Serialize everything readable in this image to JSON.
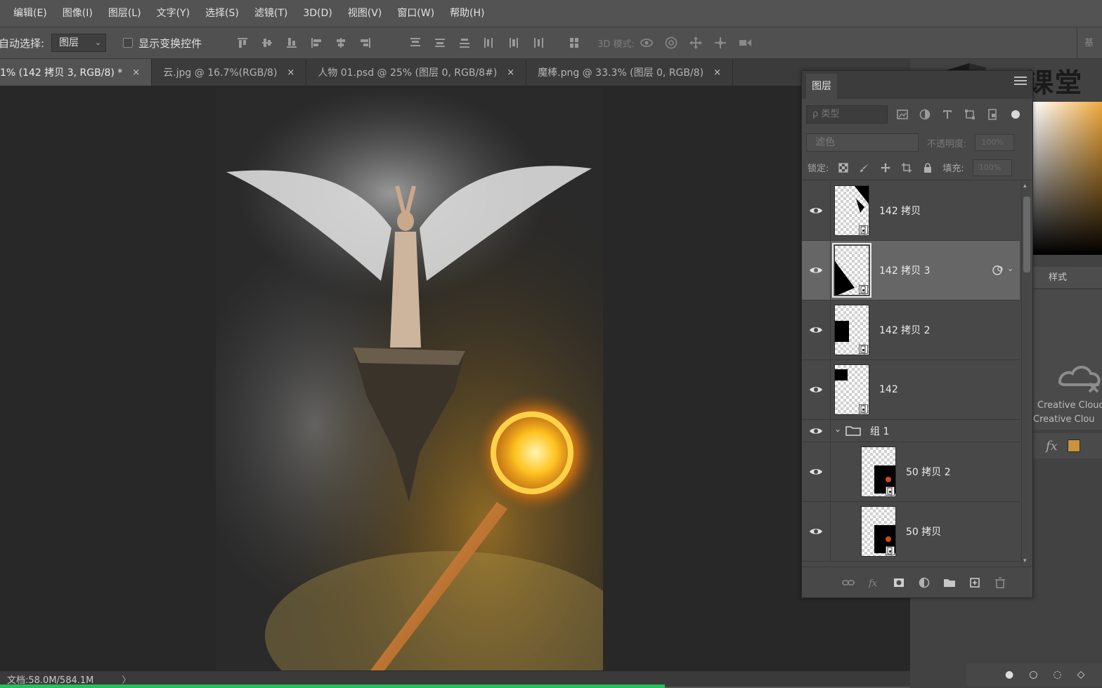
{
  "menu": {
    "items": [
      "编辑(E)",
      "图像(I)",
      "图层(L)",
      "文字(Y)",
      "选择(S)",
      "滤镜(T)",
      "3D(D)",
      "视图(V)",
      "窗口(W)",
      "帮助(H)"
    ]
  },
  "options": {
    "auto_select_label": "自动选择:",
    "auto_select_value": "图层",
    "show_transform_label": "显示变换控件",
    "mode_3d_label": "3D 模式:",
    "right_stub": "基"
  },
  "tabs": [
    {
      "title": "1% (142 拷贝 3, RGB/8) *",
      "close": "×"
    },
    {
      "title": "云.jpg @ 16.7%(RGB/8)",
      "close": "×"
    },
    {
      "title": "人物 01.psd @ 25% (图层 0, RGB/8#)",
      "close": "×"
    },
    {
      "title": "魔棒.png @ 33.3% (图层 0, RGB/8)",
      "close": "×"
    }
  ],
  "status": {
    "doc_info": "文档:58.0M/584.1M",
    "arrow": "〉",
    "progress": 0.603
  },
  "watermark": {
    "text": "云课堂"
  },
  "layers_panel": {
    "tab": "图层",
    "filter_placeholder": "ρ 类型",
    "blend_mode": "滤色",
    "opacity_label": "不透明度:",
    "opacity_value": "100%",
    "lock_label": "锁定:",
    "fill_label": "填充:",
    "fill_value": "100%",
    "layers": [
      {
        "name": "142 拷贝",
        "visible": true,
        "selected": false,
        "kind": "smart"
      },
      {
        "name": "142 拷贝 3",
        "visible": true,
        "selected": true,
        "kind": "smart"
      },
      {
        "name": "142 拷贝 2",
        "visible": true,
        "selected": false,
        "kind": "smart"
      },
      {
        "name": "142",
        "visible": true,
        "selected": false,
        "kind": "smart"
      },
      {
        "name": "组 1",
        "visible": true,
        "selected": false,
        "kind": "group"
      },
      {
        "name": "50 拷贝 2",
        "visible": true,
        "selected": false,
        "kind": "smart"
      },
      {
        "name": "50 拷贝",
        "visible": true,
        "selected": false,
        "kind": "smart"
      }
    ]
  },
  "right_dock": {
    "style_tab": "样式",
    "cc_line1": "Creative Cloud",
    "cc_line2": "Creative Clou",
    "fx_label": "fx",
    "swatch_color": "#c9943c"
  },
  "colors": {
    "accent_progress": "#21c35b",
    "panel_bg": "#484848",
    "selected_row": "#666666"
  }
}
